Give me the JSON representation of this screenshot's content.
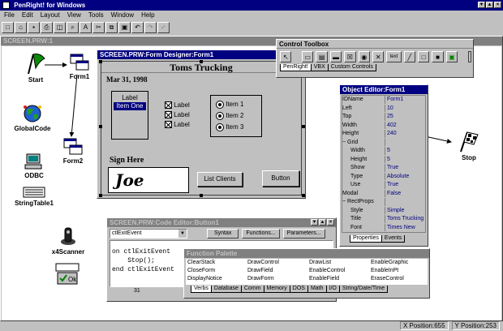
{
  "app": {
    "title": "PenRight! for Windows"
  },
  "menu": [
    "File",
    "Edit",
    "Layout",
    "View",
    "Tools",
    "Window",
    "Help"
  ],
  "screen_window": {
    "title": "SCREEN.PRW:1"
  },
  "desktop_items": [
    {
      "label": "Start"
    },
    {
      "label": "Form1"
    },
    {
      "label": "GlobalCode"
    },
    {
      "label": "Form2"
    },
    {
      "label": "ODBC"
    },
    {
      "label": "StringTable1"
    },
    {
      "label": "x4Scanner"
    },
    {
      "label": "Stop"
    }
  ],
  "form_designer": {
    "title": "SCREEN.PRW:Form Designer:Form1",
    "heading": "Toms Trucking",
    "date": "Mar 31, 1998",
    "listbox": {
      "label": "Label",
      "selected": "Item One"
    },
    "checkboxes": [
      "Label",
      "Label",
      "Label"
    ],
    "radios": [
      "Item 1",
      "Item 2",
      "Item 3"
    ],
    "sign_label": "Sign Here",
    "signature": "Joe",
    "list_button": "List Clients",
    "button": "Button"
  },
  "control_toolbox": {
    "title": "Control Toolbox",
    "text_tool": "text",
    "tabs": [
      "PenRight!",
      "VBX",
      "Custom Controls"
    ]
  },
  "object_editor": {
    "title": "Object Editor:Form1",
    "rows": [
      {
        "k": "IDName",
        "v": "Form1"
      },
      {
        "k": "Left",
        "v": "10"
      },
      {
        "k": "Top",
        "v": "25"
      },
      {
        "k": "Width",
        "v": "402"
      },
      {
        "k": "Height",
        "v": "240"
      },
      {
        "k": "− Grid",
        "v": ""
      },
      {
        "k": "Width",
        "v": "5"
      },
      {
        "k": "Height",
        "v": "5"
      },
      {
        "k": "Show",
        "v": "True"
      },
      {
        "k": "Type",
        "v": "Absolute"
      },
      {
        "k": "Use",
        "v": "True"
      },
      {
        "k": "Modal",
        "v": "False"
      },
      {
        "k": "− RectProps",
        "v": ""
      },
      {
        "k": "Style",
        "v": "Simple"
      },
      {
        "k": "Title",
        "v": "Toms Trucking"
      },
      {
        "k": "Font",
        "v": "Times New"
      }
    ],
    "tabs": [
      "Properties",
      "Events"
    ]
  },
  "code_editor": {
    "title": "SCREEN.PRW:Code Editor:Button1",
    "event_select": "ctlExitEvent",
    "buttons": [
      "Syntax",
      "Functions...",
      "Parameters..."
    ],
    "code_lines": [
      "on ctlExitEvent",
      "    Stop();",
      "end ctlExitEvent"
    ],
    "line_status": "31"
  },
  "function_palette": {
    "title": "Function Palette",
    "columns": [
      [
        "ClearStack",
        "CloseForm",
        "DisplayNotice"
      ],
      [
        "DrawControl",
        "DrawField",
        "DrawForm"
      ],
      [
        "DrawList",
        "EnableControl",
        "EnableField"
      ],
      [
        "EnableGraphic",
        "EnableInPt",
        "EraseControl"
      ]
    ],
    "tabs": [
      "Verbs",
      "Database",
      "Comm",
      "Memory",
      "DOS",
      "Math",
      "I/O",
      "String/Date/Time"
    ]
  },
  "status": {
    "x": "X Position:655",
    "y": "Y Position:253"
  }
}
